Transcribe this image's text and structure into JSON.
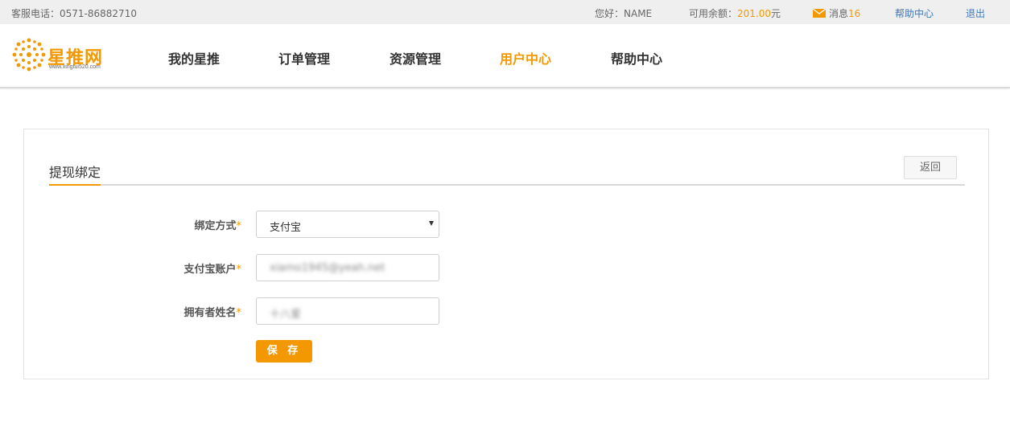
{
  "topbar": {
    "phone_label": "客服电话：",
    "phone": "0571-86882710",
    "hello_label": "您好：",
    "user_name": "NAME",
    "balance_label": "可用余额：",
    "balance": "201.00",
    "balance_unit": "元",
    "messages_label": "消息",
    "messages_count": "16",
    "help": "帮助中心",
    "logout": "退出"
  },
  "logo": {
    "brand": "星推网",
    "url": "www.xingtui520.com"
  },
  "nav": {
    "items": [
      "我的星推",
      "订单管理",
      "资源管理",
      "用户中心",
      "帮助中心"
    ],
    "active": "用户中心"
  },
  "panel": {
    "title": "提现绑定",
    "back": "返回"
  },
  "form": {
    "bind_method_label": "绑定方式",
    "bind_method_value": "支付宝",
    "account_label": "支付宝账户",
    "account_value": "xiamo1945@yeah.net",
    "owner_label": "拥有者姓名",
    "owner_value": "十八爱",
    "required_mark": "*",
    "save": "保 存"
  },
  "colors": {
    "accent": "#f39800",
    "link": "#3b78c0",
    "topbar_bg": "#efefef"
  },
  "icons": {
    "mail": "mail-icon",
    "logo": "logo-sun-icon",
    "select_arrow": "caret-down-icon"
  }
}
